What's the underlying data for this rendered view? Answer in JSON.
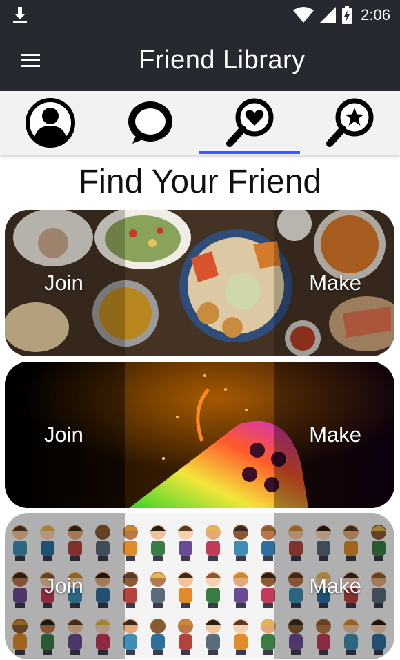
{
  "status_bar": {
    "time": "2:06"
  },
  "app_bar": {
    "title": "Friend Library"
  },
  "tabs": [
    {
      "name": "profile",
      "icon": "person-circle-icon"
    },
    {
      "name": "chat",
      "icon": "chat-bubble-icon"
    },
    {
      "name": "find-friend",
      "icon": "search-heart-icon",
      "selected": true
    },
    {
      "name": "favorites",
      "icon": "search-star-icon"
    }
  ],
  "main": {
    "heading": "Find Your Friend",
    "cards": [
      {
        "name": "food",
        "join_label": "Join",
        "make_label": "Make"
      },
      {
        "name": "game",
        "join_label": "Join",
        "make_label": "Make"
      },
      {
        "name": "people",
        "join_label": "Join",
        "make_label": "Make"
      }
    ]
  },
  "colors": {
    "app_bar": "#262a30",
    "tab_indicator": "#3d5afe",
    "tab_bar": "#f2f2f2"
  }
}
